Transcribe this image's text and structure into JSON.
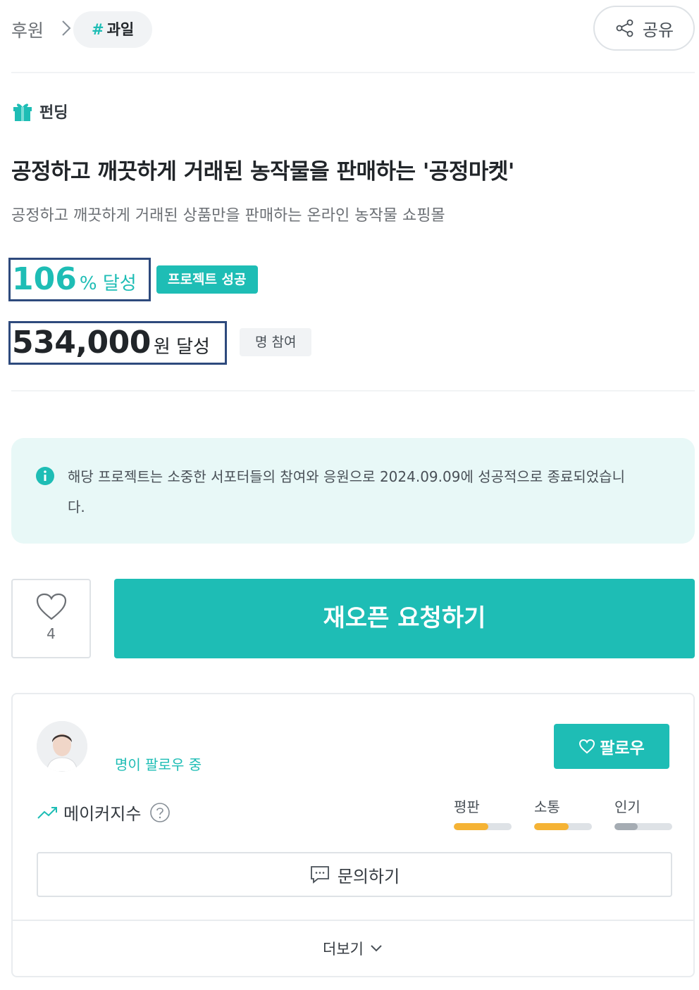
{
  "breadcrumb": {
    "root": "후원",
    "tag_hash": "#",
    "tag": "과일"
  },
  "share": {
    "label": "공유"
  },
  "project": {
    "category": "펀딩",
    "title": "공정하고 깨끗하게 거래된 농작물을 판매하는 '공정마켓'",
    "subtitle": "공정하고 깨끗하게 거래된 상품만을 판매하는 온라인 농작물 쇼핑몰"
  },
  "progress": {
    "percent": "106",
    "percent_unit": "% 달성",
    "status_badge": "프로젝트 성공",
    "amount": "534,000",
    "amount_unit": "원 달성",
    "participants": "명 참여"
  },
  "notice": {
    "text": "해당 프로젝트는 소중한 서포터들의 참여와 응원으로 2024.09.09에 성공적으로 종료되었습니다."
  },
  "actions": {
    "like_count": "4",
    "reopen_label": "재오픈 요청하기"
  },
  "maker": {
    "follower_text": "명이 팔로우 중",
    "follow_label": "팔로우",
    "index_label": "메이커지수",
    "metrics": [
      {
        "label": "평판",
        "level": 0.6,
        "color": "#f5b335"
      },
      {
        "label": "소통",
        "level": 0.6,
        "color": "#f5b335"
      },
      {
        "label": "인기",
        "level": 0.4,
        "color": "#a5acb3"
      }
    ],
    "inquiry_label": "문의하기",
    "more_label": "더보기"
  },
  "colors": {
    "accent": "#1ebdb5",
    "highlight_border": "#2e4a7d"
  }
}
